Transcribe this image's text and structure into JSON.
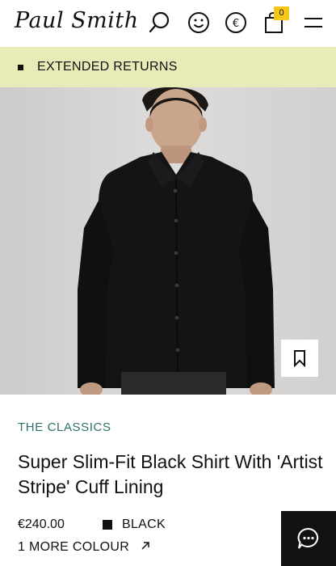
{
  "header": {
    "logo": "Paul Smith",
    "search_icon": "search-icon",
    "account_icon": "smiley-account-icon",
    "currency_icon": "euro-currency-icon",
    "bag_icon": "shopping-bag-icon",
    "bag_count": "0",
    "menu_icon": "hamburger-menu-icon"
  },
  "promo": {
    "text": "EXTENDED RETURNS"
  },
  "product": {
    "wishlist_icon": "bookmark-icon",
    "collection": "THE CLASSICS",
    "title": "Super Slim-Fit Black Shirt With 'Artist Stripe' Cuff Lining",
    "price": "€240.00",
    "colour": "BLACK",
    "more_colours": "1 MORE COLOUR",
    "more_colours_icon": "arrow-up-right-icon"
  },
  "chat": {
    "icon": "chat-bubble-icon"
  },
  "colors": {
    "promo_bg": "#e7ebb8",
    "collection_text": "#2f6f6b",
    "badge": "#f5c518"
  }
}
